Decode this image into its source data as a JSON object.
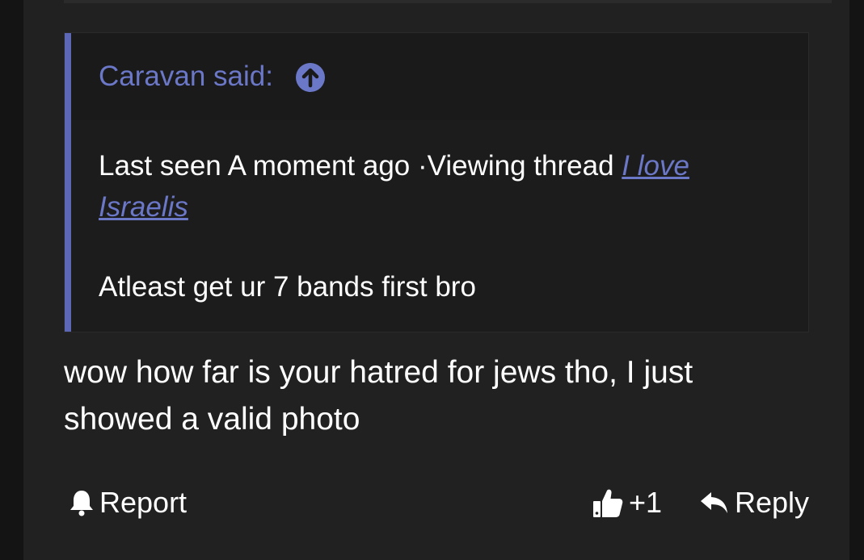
{
  "quote": {
    "author": "Caravan said:",
    "body_prefix": "Last seen A moment ago ·Viewing thread ",
    "link_text": "I love Israelis",
    "body_line2": "Atleast get ur 7 bands first bro"
  },
  "message": {
    "text": "wow how far is your hatred for jews tho, I just showed a valid photo"
  },
  "actions": {
    "report_label": "Report",
    "like_label": "+1",
    "reply_label": "Reply"
  },
  "icons": {
    "jump": "arrow-up-circle-icon",
    "report": "bell-icon",
    "like": "thumbs-up-icon",
    "reply": "reply-arrow-icon"
  },
  "colors": {
    "accent": "#6b77c7",
    "quote_bar": "#5c67b5",
    "background": "#212121",
    "text": "#ffffff"
  }
}
